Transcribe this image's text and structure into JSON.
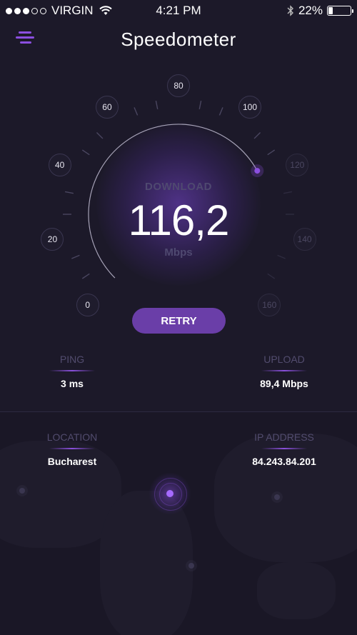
{
  "status_bar": {
    "carrier": "VIRGIN",
    "time": "4:21 PM",
    "battery_text": "22%",
    "battery_level": 0.22,
    "signal_bars_filled": 3,
    "signal_bars_total": 5
  },
  "header": {
    "title": "Speedometer",
    "menu_icon": "menu-icon"
  },
  "gauge": {
    "scale_labels": [
      "0",
      "20",
      "40",
      "60",
      "80",
      "100",
      "120",
      "140",
      "160"
    ],
    "scale_max": 160,
    "needle_value": 116.2,
    "metric_label": "DOWNLOAD",
    "value": "116,2",
    "unit": "Mbps",
    "accent_color": "#8b4fe0"
  },
  "actions": {
    "retry_label": "RETRY"
  },
  "stats": {
    "ping": {
      "label": "PING",
      "value": "3 ms"
    },
    "upload": {
      "label": "UPLOAD",
      "value": "89,4 Mbps"
    },
    "location": {
      "label": "LOCATION",
      "value": "Bucharest"
    },
    "ip_address": {
      "label": "IP ADDRESS",
      "value": "84.243.84.201"
    }
  },
  "colors": {
    "background": "#1c1929",
    "accent": "#8b4fe0",
    "button": "#6a3ea8",
    "muted_text": "#524c6e"
  }
}
